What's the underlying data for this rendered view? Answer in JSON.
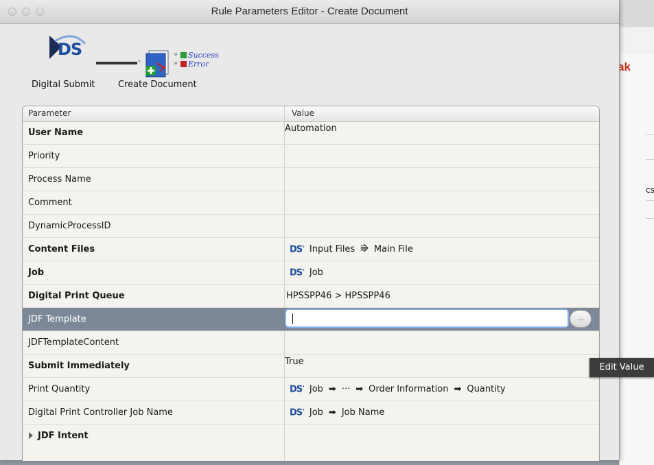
{
  "window": {
    "title": "Rule Parameters Editor - Create Document"
  },
  "background_app": {
    "brand_fragment": "ak",
    "label_fragment": "cs"
  },
  "flow": {
    "source_label": "Digital Submit",
    "source_logo_text": "DS",
    "target_label": "Create Document",
    "success_label": "Success",
    "error_label": "Error"
  },
  "table": {
    "headers": {
      "parameter": "Parameter",
      "value": "Value"
    },
    "rows": [
      {
        "param": "User Name",
        "bold": true,
        "value": "Automation"
      },
      {
        "param": "Priority",
        "bold": false,
        "value": ""
      },
      {
        "param": "Process Name",
        "bold": false,
        "value": ""
      },
      {
        "param": "Comment",
        "bold": false,
        "value": ""
      },
      {
        "param": "DynamicProcessID",
        "bold": false,
        "value": ""
      },
      {
        "param": "Content Files",
        "bold": true,
        "value_path": [
          "Input Files",
          "Main File"
        ]
      },
      {
        "param": "Job",
        "bold": true,
        "value_path": [
          "Job"
        ]
      },
      {
        "param": "Digital Print Queue",
        "bold": true,
        "value": "HPSSPP46 > HPSSPP46"
      },
      {
        "param": "JDF Template",
        "bold": false,
        "value": "",
        "selected": true
      },
      {
        "param": "JDFTemplateContent",
        "bold": false,
        "value": ""
      },
      {
        "param": "Submit Immediately",
        "bold": true,
        "value": "True"
      },
      {
        "param": "Print Quantity",
        "bold": false,
        "value_path": [
          "Job",
          "···",
          "Order Information",
          "Quantity"
        ]
      },
      {
        "param": "Digital Print Controller Job Name",
        "bold": false,
        "value_path": [
          "Job",
          "Job Name"
        ]
      }
    ],
    "group": {
      "label": "JDF Intent",
      "expanded": false
    },
    "ds_prefix": "DS",
    "path_arrow": "➡",
    "ellipsis_button": "..."
  },
  "tooltip": {
    "text": "Edit Value"
  },
  "colors": {
    "selection": "#7c8797",
    "ds_blue": "#1c4e9e",
    "result_blue": "#2a43c6",
    "input_focus": "#86b0e8"
  }
}
